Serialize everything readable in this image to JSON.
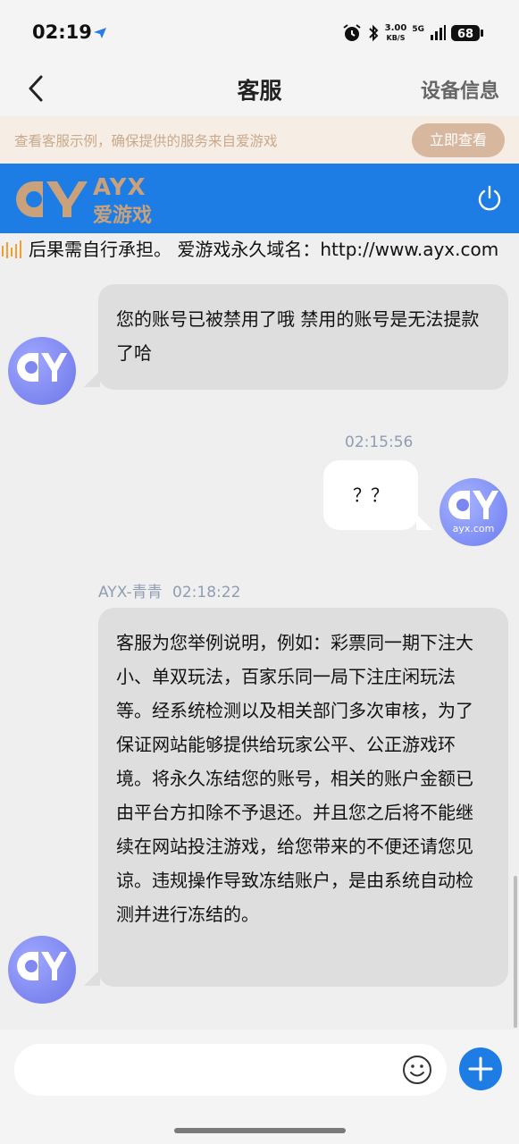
{
  "status_bar": {
    "time": "02:19",
    "net_speed_value": "3.00",
    "net_speed_unit": "KB/S",
    "network_type": "5G",
    "battery": "68"
  },
  "header": {
    "title": "客服",
    "device_info": "设备信息"
  },
  "notice": {
    "text": "查看客服示例，确保提供的服务来自爱游戏",
    "button": "立即查看"
  },
  "brand": {
    "name_en": "AYX",
    "name_cn": "爱游戏"
  },
  "marquee": {
    "text": "后果需自行承担。 爱游戏永久域名：http://www.ayx.com"
  },
  "messages": [
    {
      "side": "left",
      "text": " 您的账号已被禁用了哦  禁用的账号是无法提款了哈"
    },
    {
      "side": "right",
      "time": "02:15:56",
      "text": "？？",
      "avatar_label": "ayx.com"
    },
    {
      "side": "left",
      "sender": "AYX-青青",
      "time": "02:18:22",
      "text": "客服为您举例说明，例如：彩票同一期下注大小、单双玩法，百家乐同一局下注庄闲玩法等。经系统检测以及相关部门多次审核，为了保证网站能够提供给玩家公平、公正游戏环境。将永久冻结您的账号，相关的账户金额已由平台方扣除不予退还。并且您之后将不能继续在网站投注游戏，给您带来的不便还请您见谅。违规操作导致冻结账户，是由系统自动检测并进行冻结的。"
    }
  ],
  "input": {
    "placeholder": ""
  },
  "colors": {
    "brand_blue": "#1e7de4",
    "brand_gold": "#c9a17b",
    "notice_bg": "#f6ede4",
    "bubble_gray": "#dedede"
  }
}
